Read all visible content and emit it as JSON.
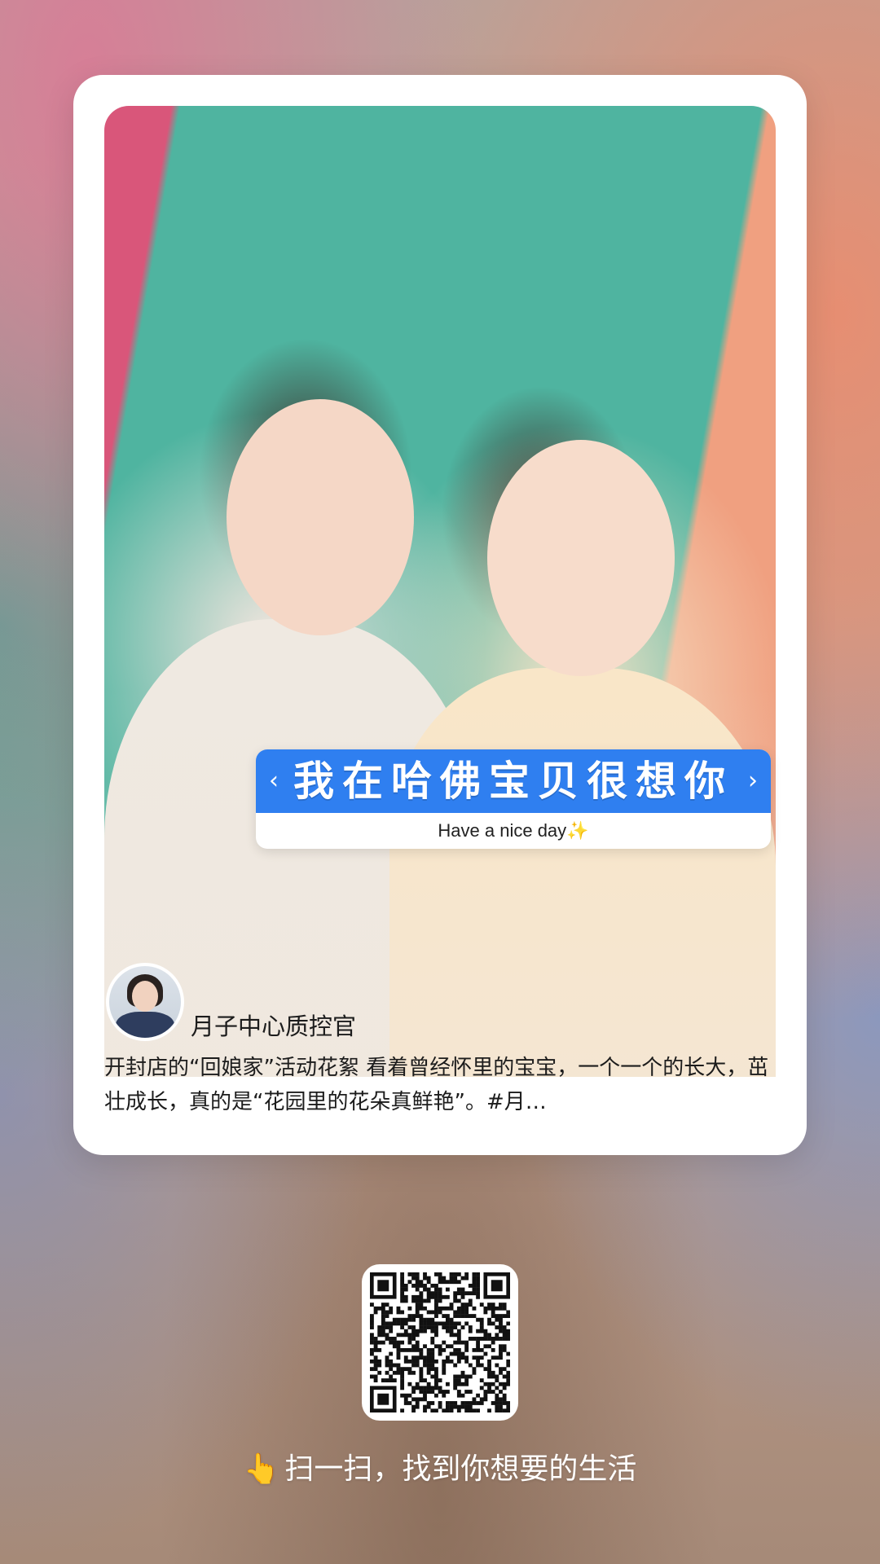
{
  "post": {
    "banner": {
      "title": "我在哈佛宝贝很想你",
      "subtitle": "Have a nice day",
      "subtitle_emoji": "✨",
      "prev_icon": "chevron-left-icon",
      "next_icon": "chevron-right-icon",
      "prev_glyph": "‹",
      "next_glyph": "›",
      "accent_color": "#2f7ff0"
    },
    "author": "月子中心质控官",
    "description": "开封店的“回娘家”活动花絮 看着曾经怀里的宝宝，一个一个的长大，茁壮成长，真的是“花园里的花朵真鲜艳”。#月…"
  },
  "share": {
    "qr_icon": "qr-code-icon",
    "hand_emoji": "👆",
    "cta": "扫一扫，找到你想要的生活"
  }
}
